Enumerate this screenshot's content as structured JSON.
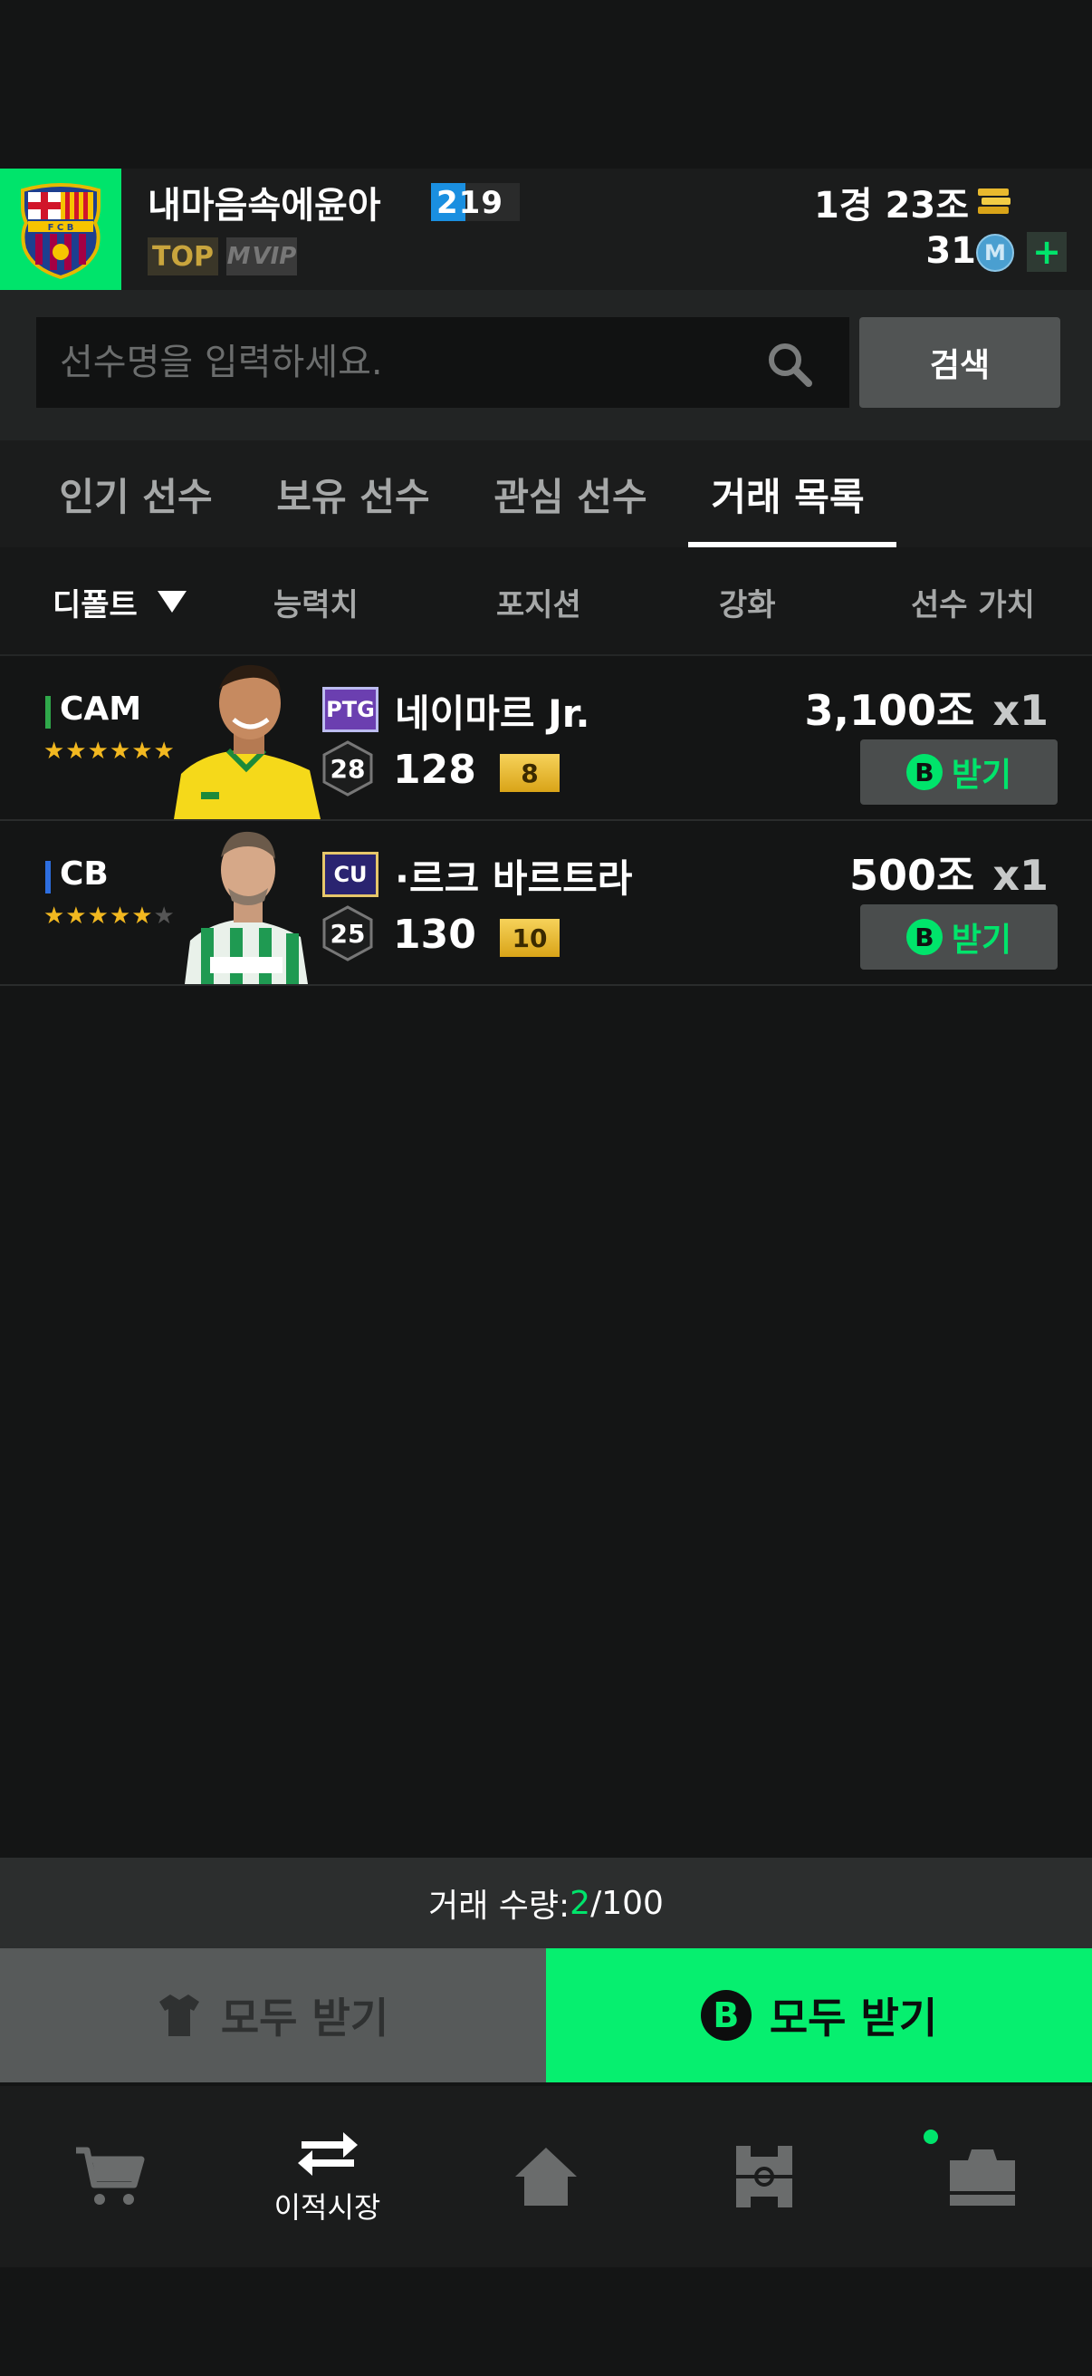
{
  "header": {
    "username": "내마음속에윤아",
    "level": "219",
    "badge_top": "TOP",
    "badge_vip": "VIP",
    "bp_amount": "1경 23조",
    "m_amount": "31",
    "m_icon_label": "M",
    "plus_label": "+"
  },
  "search": {
    "placeholder": "선수명을 입력하세요.",
    "button_label": "검색"
  },
  "tabs": [
    {
      "label": "인기 선수",
      "active": false
    },
    {
      "label": "보유 선수",
      "active": false
    },
    {
      "label": "관심 선수",
      "active": false
    },
    {
      "label": "거래 목록",
      "active": true
    }
  ],
  "sort": {
    "default_label": "디폴트",
    "options": [
      "능력치",
      "포지션",
      "강화",
      "선수 가치"
    ]
  },
  "players": [
    {
      "position": "CAM",
      "position_color": "#2fa84a",
      "stars_filled": 6,
      "stars_total": 6,
      "season": "PTG",
      "season_color": "#6b3fb0",
      "pay": "28",
      "name": "네이마르 Jr.",
      "ovr": "128",
      "grade": "8",
      "price": "3,100조",
      "qty": "x1",
      "receive_label": "받기",
      "coin_label": "B"
    },
    {
      "position": "CB",
      "position_color": "#2d6ee0",
      "stars_filled": 5,
      "stars_total": 6,
      "season": "CU",
      "season_color": "#2a2470",
      "pay": "25",
      "name": "·르크 바르트라",
      "ovr": "130",
      "grade": "10",
      "price": "500조",
      "qty": "x1",
      "receive_label": "받기",
      "coin_label": "B"
    }
  ],
  "trade": {
    "label": "거래 수량: ",
    "current": "2",
    "max": "/100"
  },
  "buttons": {
    "receive_all_grey": "모두 받기",
    "receive_all_green": "모두 받기",
    "coin_label": "B"
  },
  "nav": {
    "transfer_label": "이적시장"
  },
  "colors": {
    "accent": "#06ef6f",
    "background": "#141515"
  }
}
